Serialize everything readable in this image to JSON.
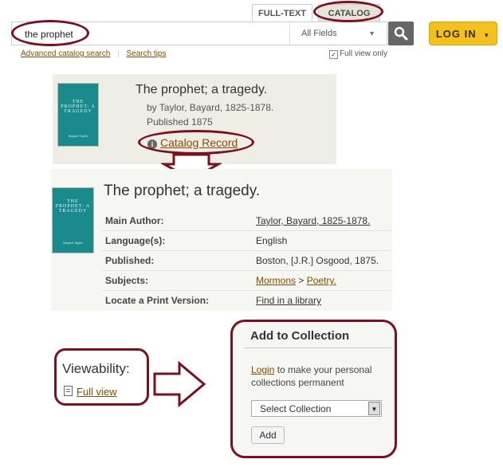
{
  "tabs": [
    {
      "label": "FULL-TEXT"
    },
    {
      "label": "CATALOG"
    }
  ],
  "search": {
    "value": "the prophet",
    "field": "All Fields",
    "login_label": "LOG IN",
    "advanced_link": "Advanced catalog search",
    "tips_link": "Search tips",
    "full_view_label": "Full view only",
    "full_view_checked": true
  },
  "result": {
    "title": "The prophet; a tragedy.",
    "author": "by Taylor, Bayard, 1825-1878.",
    "published": "Published 1875",
    "catalog_link": "Catalog Record",
    "cover_title": "THE PROPHET: A TRAGEDY",
    "cover_author": "Bayard Taylor"
  },
  "detail": {
    "title": "The prophet; a tragedy.",
    "rows": [
      {
        "label": "Main Author:",
        "value": "Taylor, Bayard, 1825-1878."
      },
      {
        "label": "Language(s):",
        "value": "English"
      },
      {
        "label": "Published:",
        "value": "Boston, [J.R.] Osgood, 1875."
      },
      {
        "label": "Subjects:",
        "value_a": "Mormons",
        "sep": " > ",
        "value_b": "Poetry."
      },
      {
        "label": "Locate a Print Version:",
        "value": "Find in a library"
      }
    ]
  },
  "viewability": {
    "label": "Viewability:",
    "link": "Full view"
  },
  "collection": {
    "heading": "Add to Collection",
    "login_link": "Login",
    "text": " to make your personal collections permanent",
    "select_value": "Select Collection",
    "add_label": "Add"
  },
  "colors": {
    "annotation": "#7a1020",
    "link": "#8a4b00",
    "login_button": "#f3c01e",
    "cover": "#1a8a8d"
  }
}
